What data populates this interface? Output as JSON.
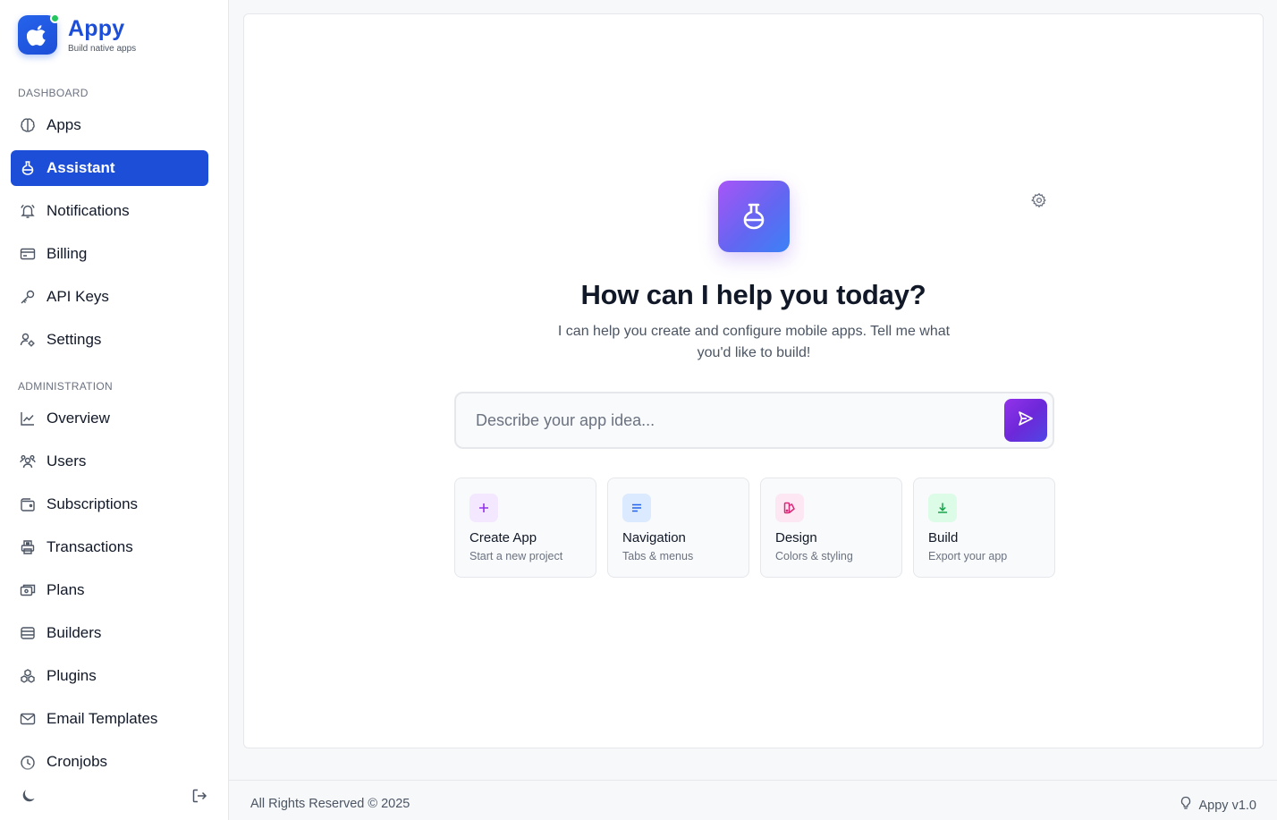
{
  "brand": {
    "name": "Appy",
    "tagline": "Build native apps",
    "status": "online"
  },
  "sidebar": {
    "sections": [
      {
        "label": "DASHBOARD",
        "items": [
          {
            "label": "Apps",
            "icon": "brain-icon"
          },
          {
            "label": "Assistant",
            "icon": "flask-icon",
            "active": true
          },
          {
            "label": "Notifications",
            "icon": "bell-icon"
          },
          {
            "label": "Billing",
            "icon": "credit-card-icon"
          },
          {
            "label": "API Keys",
            "icon": "key-icon"
          },
          {
            "label": "Settings",
            "icon": "user-settings-icon"
          }
        ]
      },
      {
        "label": "ADMINISTRATION",
        "items": [
          {
            "label": "Overview",
            "icon": "chart-line-icon"
          },
          {
            "label": "Users",
            "icon": "users-icon"
          },
          {
            "label": "Subscriptions",
            "icon": "wallet-icon"
          },
          {
            "label": "Transactions",
            "icon": "printer-icon"
          },
          {
            "label": "Plans",
            "icon": "plans-icon"
          },
          {
            "label": "Builders",
            "icon": "stack-icon"
          },
          {
            "label": "Plugins",
            "icon": "boxes-icon"
          },
          {
            "label": "Email Templates",
            "icon": "mail-icon"
          },
          {
            "label": "Cronjobs",
            "icon": "clock-icon"
          }
        ]
      }
    ],
    "theme_toggle_icon": "moon-icon",
    "logout_icon": "logout-icon"
  },
  "assistant": {
    "icon": "flask-icon",
    "settings_icon": "gear-icon",
    "title": "How can I help you today?",
    "subtitle": "I can help you create and configure mobile apps. Tell me what you'd like to build!",
    "input": {
      "placeholder": "Describe your app idea...",
      "value": ""
    },
    "send_icon": "send-icon",
    "quick_actions": [
      {
        "title": "Create App",
        "subtitle": "Start a new project",
        "icon": "plus-icon",
        "accent": "#9333ea",
        "bg": "#f3e8ff"
      },
      {
        "title": "Navigation",
        "subtitle": "Tabs & menus",
        "icon": "menu-lines-icon",
        "accent": "#2563eb",
        "bg": "#dbeafe"
      },
      {
        "title": "Design",
        "subtitle": "Colors & styling",
        "icon": "palette-icon",
        "accent": "#db2777",
        "bg": "#fce7f3"
      },
      {
        "title": "Build",
        "subtitle": "Export your app",
        "icon": "download-icon",
        "accent": "#16a34a",
        "bg": "#dcfce7"
      }
    ]
  },
  "footer": {
    "copyright": "All Rights Reserved © 2025",
    "version": "Appy v1.0",
    "version_icon": "lightbulb-icon"
  },
  "colors": {
    "primary": "#1d4ed8",
    "accent_gradient": [
      "#a855f7",
      "#3b82f6"
    ],
    "status_online": "#22c55e"
  }
}
